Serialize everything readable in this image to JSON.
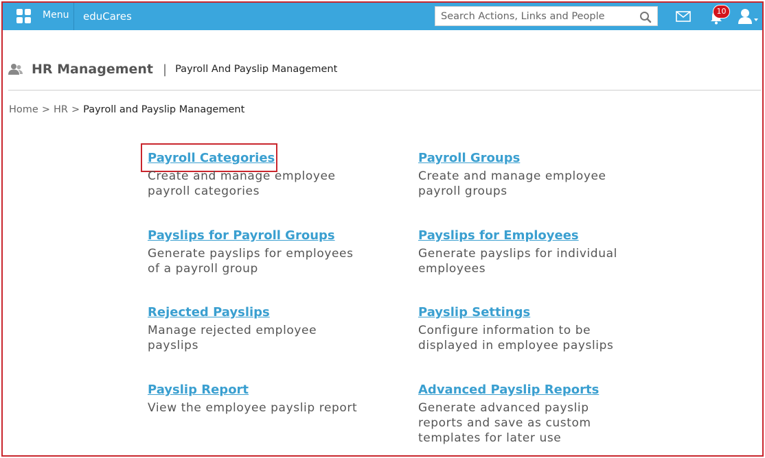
{
  "topbar": {
    "menu_label": "Menu",
    "brand": "eduCares",
    "search_placeholder": "Search Actions, Links and People",
    "notification_count": "10"
  },
  "header": {
    "title": "HR Management",
    "separator": "|",
    "subtitle": "Payroll And Payslip Management"
  },
  "breadcrumb": {
    "items": [
      "Home",
      "HR"
    ],
    "separator": ">",
    "current": "Payroll and Payslip Management"
  },
  "cards": [
    {
      "title": "Payroll Categories",
      "desc": "Create and manage employee payroll categories"
    },
    {
      "title": "Payroll Groups",
      "desc": "Create and manage employee payroll groups"
    },
    {
      "title": "Payslips for Payroll Groups",
      "desc": "Generate payslips for employees of a payroll group"
    },
    {
      "title": "Payslips for Employees",
      "desc": "Generate payslips for individual employees"
    },
    {
      "title": "Rejected Payslips",
      "desc": "Manage rejected employee payslips"
    },
    {
      "title": "Payslip Settings",
      "desc": "Configure information to be displayed in employee payslips"
    },
    {
      "title": "Payslip Report",
      "desc": "View the employee payslip report"
    },
    {
      "title": "Advanced Payslip Reports",
      "desc": "Generate advanced payslip reports and save as custom templates for later use"
    }
  ],
  "colors": {
    "topbar": "#3aa6dd",
    "link": "#3a9fd0",
    "highlight": "#c9252c",
    "badge": "#d4141c"
  }
}
